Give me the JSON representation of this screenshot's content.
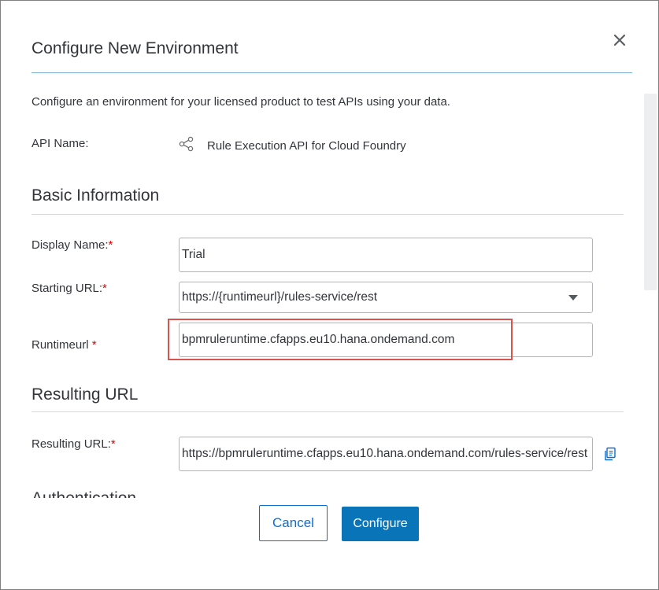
{
  "dialog": {
    "title": "Configure New Environment",
    "description": "Configure an environment for your licensed product to test APIs using your data.",
    "close_icon": "close-icon"
  },
  "api": {
    "label": "API Name:",
    "value": "Rule Execution API for Cloud Foundry",
    "icon": "share-icon"
  },
  "basic_info": {
    "heading": "Basic Information",
    "display_name": {
      "label": "Display Name:",
      "required": "*",
      "value": "Trial"
    },
    "starting_url": {
      "label": "Starting URL:",
      "required": "*",
      "value": "https://{runtimeurl}/rules-service/rest"
    },
    "runtimeurl": {
      "label": "Runtimeurl",
      "required": "*",
      "value": "bpmruleruntime.cfapps.eu10.hana.ondemand.com"
    }
  },
  "resulting": {
    "heading": "Resulting URL",
    "label": "Resulting URL:",
    "required": "*",
    "value": "https://bpmruleruntime.cfapps.eu10.hana.ondemand.com/rules-service/rest",
    "copy_icon": "copy-icon"
  },
  "authentication": {
    "heading": "Authentication"
  },
  "footer": {
    "cancel_label": "Cancel",
    "configure_label": "Configure"
  },
  "colors": {
    "accent": "#0a6ed1",
    "primary_button": "#0a74b8",
    "required": "#e00000",
    "highlight": "#d9534f"
  }
}
